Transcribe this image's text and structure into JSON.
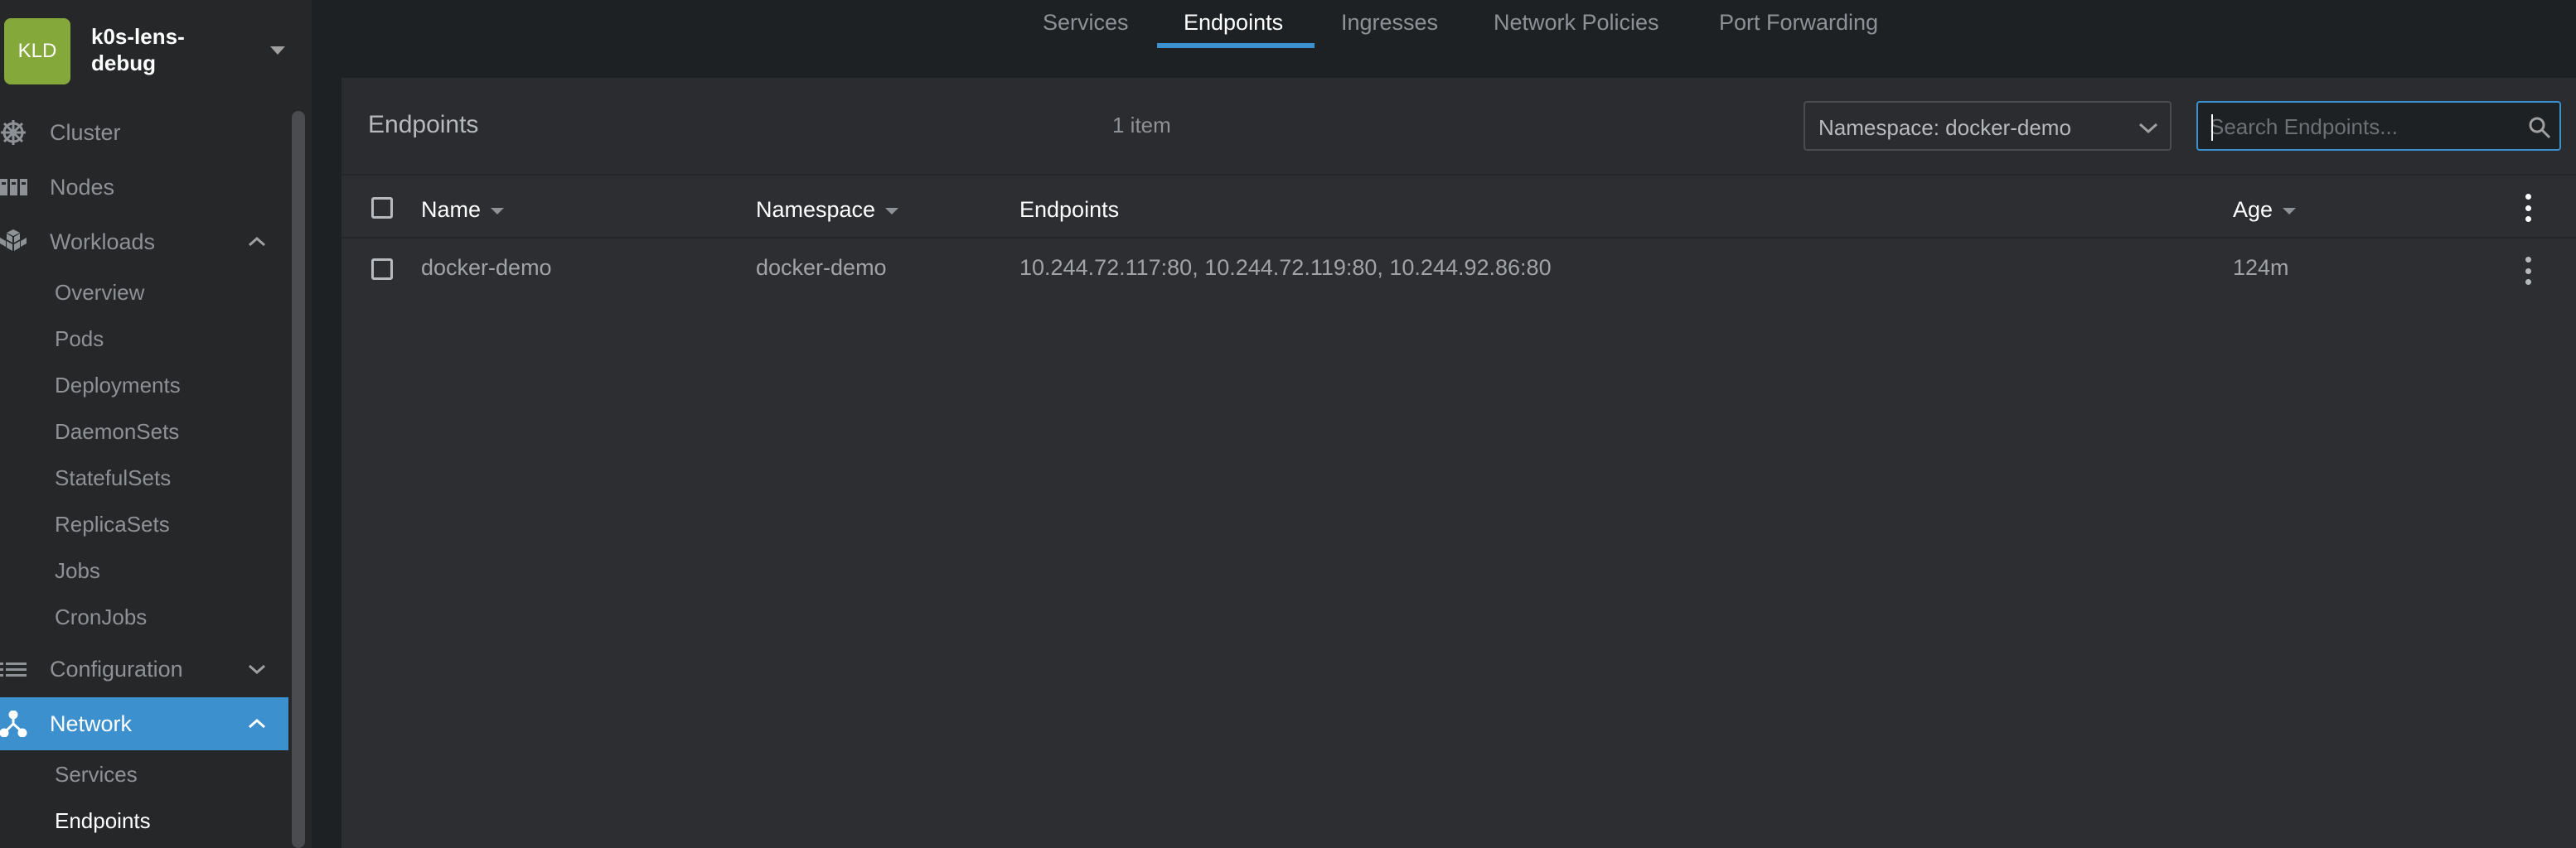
{
  "cluster": {
    "avatar": "KLD",
    "name": "k0s-lens-debug"
  },
  "sidebar": {
    "sections": [
      {
        "label": "Cluster",
        "icon": "helm-wheel-icon"
      },
      {
        "label": "Nodes",
        "icon": "nodes-icon"
      },
      {
        "label": "Workloads",
        "icon": "workloads-icon",
        "expanded": true,
        "items": [
          "Overview",
          "Pods",
          "Deployments",
          "DaemonSets",
          "StatefulSets",
          "ReplicaSets",
          "Jobs",
          "CronJobs"
        ]
      },
      {
        "label": "Configuration",
        "icon": "list-icon",
        "expanded": false
      },
      {
        "label": "Network",
        "icon": "network-icon",
        "expanded": true,
        "active": true,
        "items": [
          "Services",
          "Endpoints"
        ]
      }
    ],
    "current_item": "Endpoints"
  },
  "tabs": [
    {
      "label": "Services"
    },
    {
      "label": "Endpoints",
      "active": true
    },
    {
      "label": "Ingresses"
    },
    {
      "label": "Network Policies"
    },
    {
      "label": "Port Forwarding"
    }
  ],
  "panel": {
    "title": "Endpoints",
    "count": "1 item",
    "namespace_select": "Namespace: docker-demo",
    "search_placeholder": "Search Endpoints..."
  },
  "table": {
    "columns": {
      "name": "Name",
      "namespace": "Namespace",
      "endpoints": "Endpoints",
      "age": "Age"
    },
    "rows": [
      {
        "name": "docker-demo",
        "namespace": "docker-demo",
        "endpoints": "10.244.72.117:80, 10.244.72.119:80, 10.244.92.86:80",
        "age": "124m"
      }
    ]
  },
  "colors": {
    "accent": "#3d90ce",
    "cluster_avatar": "#85a83a",
    "background": "#1e2124",
    "sidebar": "#252729",
    "panel": "#2c2e31"
  }
}
